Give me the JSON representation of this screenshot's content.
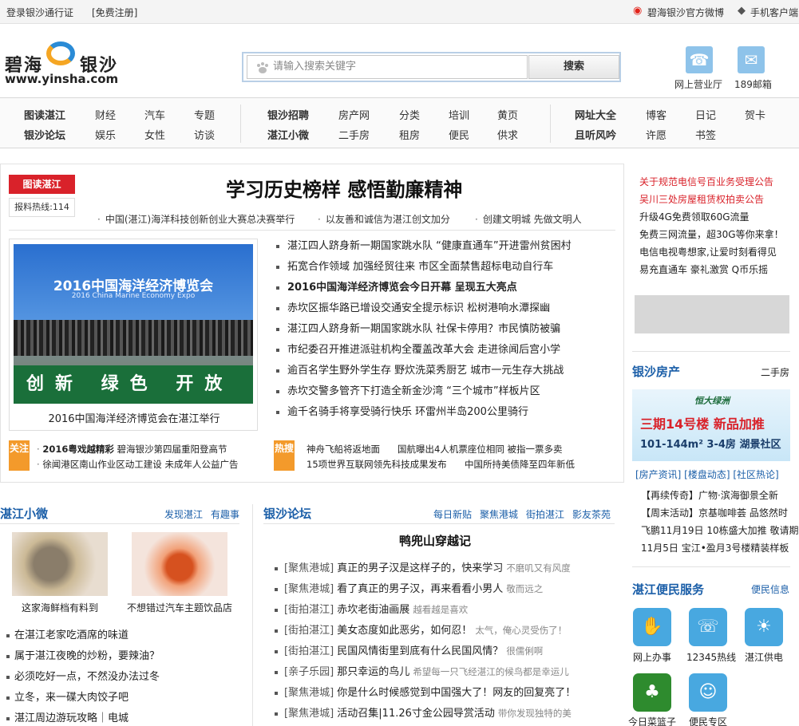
{
  "topbar": {
    "login": "登录银沙通行证",
    "register": "[免费注册]",
    "weibo": "碧海银沙官方微博",
    "mobile": "手机客户端"
  },
  "header": {
    "logo_zh_left": "碧海",
    "logo_zh_right": "银沙",
    "logo_url": "www.yinsha.com",
    "search_placeholder": "请输入搜索关键字",
    "search_button": "搜索",
    "online_hall": "网上营业厅",
    "mail_189": "189邮箱"
  },
  "nav": {
    "group1": [
      {
        "label": "图读湛江",
        "bold": true
      },
      {
        "label": "财经"
      },
      {
        "label": "汽车"
      },
      {
        "label": "专题"
      },
      {
        "label": "银沙论坛",
        "bold": true
      },
      {
        "label": "娱乐"
      },
      {
        "label": "女性"
      },
      {
        "label": "访谈"
      }
    ],
    "group2": [
      {
        "label": "银沙招聘",
        "bold": true
      },
      {
        "label": "房产网"
      },
      {
        "label": "分类"
      },
      {
        "label": "培训"
      },
      {
        "label": "黄页"
      },
      {
        "label": "湛江小微",
        "bold": true
      },
      {
        "label": "二手房"
      },
      {
        "label": "租房"
      },
      {
        "label": "便民"
      },
      {
        "label": "供求"
      }
    ],
    "group3": [
      {
        "label": "网址大全",
        "bold": true
      },
      {
        "label": "博客"
      },
      {
        "label": "日记"
      },
      {
        "label": "贺卡"
      },
      {
        "label": "且听风吟",
        "bold": true
      },
      {
        "label": "许愿"
      },
      {
        "label": "书签"
      }
    ]
  },
  "main": {
    "tag": "图读湛江",
    "hotline": "报料热线:114",
    "headline": "学习历史榜样 感悟勤廉精神",
    "sub_headlines": [
      "中国(湛江)海洋科技创新创业大赛总决赛举行",
      "以友善和诚信为湛江创文加分",
      "创建文明城 先做文明人"
    ],
    "photo_banner_title": "2016中国海洋经济博览会",
    "photo_banner_sub": "2016 China Marine Economy Expo",
    "photo_ground_text": "创新 绿色 开放",
    "photo_caption": "2016中国海洋经济博览会在湛江举行",
    "news": [
      {
        "text": "湛江四人跻身新一期国家跳水队 “健康直通车”开进雷州贫困村",
        "bold": false
      },
      {
        "text": "拓宽合作领域 加强经贸往来  市区全面禁售超标电动自行车",
        "bold": false
      },
      {
        "text": "2016中国海洋经济博览会今日开幕 呈现五大亮点",
        "bold": true
      },
      {
        "text": "赤坎区振华路已增设交通安全提示标识  松树港响水潭探幽",
        "bold": false
      },
      {
        "text": "湛江四人跻身新一期国家跳水队  社保卡停用？市民慎防被骗",
        "bold": false
      },
      {
        "text": "市纪委召开推进派驻机构全覆盖改革大会  走进徐闻后宫小学",
        "bold": false
      },
      {
        "text": "逾百名学生野外学生存 野炊洗菜秀厨艺  城市一元生存大挑战",
        "bold": false
      },
      {
        "text": "赤坎交警多管齐下打造全新金沙湾 “三个城市”样板片区",
        "bold": false
      },
      {
        "text": "逾千名骑手将享受骑行快乐 环雷州半岛200公里骑行",
        "bold": false
      }
    ],
    "focus_tag": "关注",
    "focus_lines": [
      {
        "bold_part": "2016粤戏越精彩",
        "rest": " 碧海银沙第四届重阳登高节"
      },
      {
        "bold_part": "",
        "rest": "徐闻港区南山作业区动工建设 未成年人公益广告"
      }
    ],
    "hot_tag": "热搜",
    "hot_lines": [
      [
        "神舟飞船将返地面",
        "国航曝出4人机票座位相同 被指一票多卖"
      ],
      [
        "15项世界互联网领先科技成果发布",
        "中国所持美债降至四年新低"
      ]
    ]
  },
  "right": {
    "notices": [
      {
        "text": "关于规范电信号百业务受理公告",
        "red": true
      },
      {
        "text": "吴川三处房屋租赁权拍卖公告",
        "red": true
      },
      {
        "text": "升级4G免费领取60G流量",
        "red": false
      },
      {
        "text": "免费三网流量，超30G等你来拿！",
        "red": false
      },
      {
        "text": "电信电视粤想家,让爱时刻看得见",
        "red": false
      },
      {
        "text": "易充直通车 豪礼激赏 Q币乐摇",
        "red": false
      }
    ],
    "house_title": "银沙房产",
    "house_more": "二手房",
    "house_ad_brand": "恒大绿洲",
    "house_ad_line1": "三期14号楼 新品加推",
    "house_ad_line2": "101-144m² 3-4房 湖景社区",
    "house_links": "[房产资讯]  [楼盘动态]  [社区热论]",
    "house_news": [
      "【再续传奇】广物·滨海御景全新",
      "【周末活动】京基咖啡荟 品悠然时",
      "飞鹏11月19日 10栋盛大加推 敬请期",
      "11月5日 宝江•盈月3号楼精装样板"
    ],
    "service_title": "湛江便民服务",
    "service_more": "便民信息",
    "services": [
      {
        "label": "网上办事",
        "icon": "hand-icon"
      },
      {
        "label": "12345热线",
        "icon": "headset-icon"
      },
      {
        "label": "湛江供电",
        "icon": "bulb-icon"
      },
      {
        "label": "今日菜篮子",
        "icon": "basket-icon"
      },
      {
        "label": "便民专区",
        "icon": "smile-icon"
      }
    ]
  },
  "weibo_section": {
    "title": "湛江小微",
    "more1": "发现湛江",
    "more2": "有趣事",
    "thumbs": [
      {
        "caption": "这家海鲜档有料到"
      },
      {
        "caption": "不想错过汽车主题饮品店"
      }
    ],
    "list": [
      "在湛江老家吃酒席的味道",
      "属于湛江夜晚的炒粉，要辣油？",
      "必须吃好一点，不然没办法过冬",
      "立冬，来一碟大肉饺子吧",
      "湛江周边游玩攻略｜电城"
    ]
  },
  "forum_section": {
    "title": "银沙论坛",
    "links": [
      "每日新贴",
      "聚焦港城",
      "街拍湛江",
      "影友茶苑"
    ],
    "topic_title": "鸭兜山穿越记",
    "posts": [
      {
        "tag": "[聚焦港城]",
        "text": "真正的男子汉是这样子的，快来学习",
        "extra": "不磨叽又有风度"
      },
      {
        "tag": "[聚焦港城]",
        "text": "看了真正的男子汉，再来看看小男人",
        "extra": "敬而远之"
      },
      {
        "tag": "[街拍湛江]",
        "text": "赤坎老街油画展",
        "extra": "越看越是喜欢"
      },
      {
        "tag": "[街拍湛江]",
        "text": "美女态度如此恶劣，如何忍！",
        "extra": "太气，俺心灵受伤了！"
      },
      {
        "tag": "[街拍湛江]",
        "text": "民国风情街里到底有什么民国风情？",
        "extra": "很儒俐啊"
      },
      {
        "tag": "[亲子乐园]",
        "text": "那只幸运的鸟儿",
        "extra": "希望每一只飞经湛江的候鸟都是幸运儿"
      },
      {
        "tag": "[聚焦港城]",
        "text": "你是什么时候感觉到中国强大了！网友的回复亮了！",
        "extra": ""
      },
      {
        "tag": "[聚焦港城]",
        "text": "活动召集|11.26寸金公园导赏活动",
        "extra": "带你发现独特的美"
      }
    ]
  },
  "colors": {
    "brand_blue": "#1a5ea8",
    "tag_red": "#d9222a",
    "tag_orange": "#f39a2b"
  }
}
